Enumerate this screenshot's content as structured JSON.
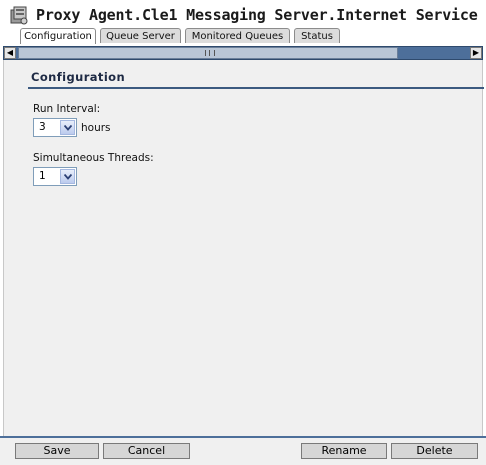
{
  "window": {
    "title": "Proxy Agent.Cle1 Messaging Server.Internet Service",
    "icon": "server-icon"
  },
  "tabs": [
    {
      "label": "Configuration",
      "active": true
    },
    {
      "label": "Queue Server",
      "active": false
    },
    {
      "label": "Monitored Queues",
      "active": false
    },
    {
      "label": "Status",
      "active": false
    }
  ],
  "section": {
    "title": "Configuration"
  },
  "fields": {
    "run_interval": {
      "label": "Run Interval:",
      "value": "3",
      "unit": "hours"
    },
    "threads": {
      "label": "Simultaneous Threads:",
      "value": "1"
    }
  },
  "buttons": {
    "save": "Save",
    "cancel": "Cancel",
    "rename": "Rename",
    "delete": "Delete"
  },
  "colors": {
    "accent": "#4d6f9a",
    "panel": "#f0f0f0"
  }
}
